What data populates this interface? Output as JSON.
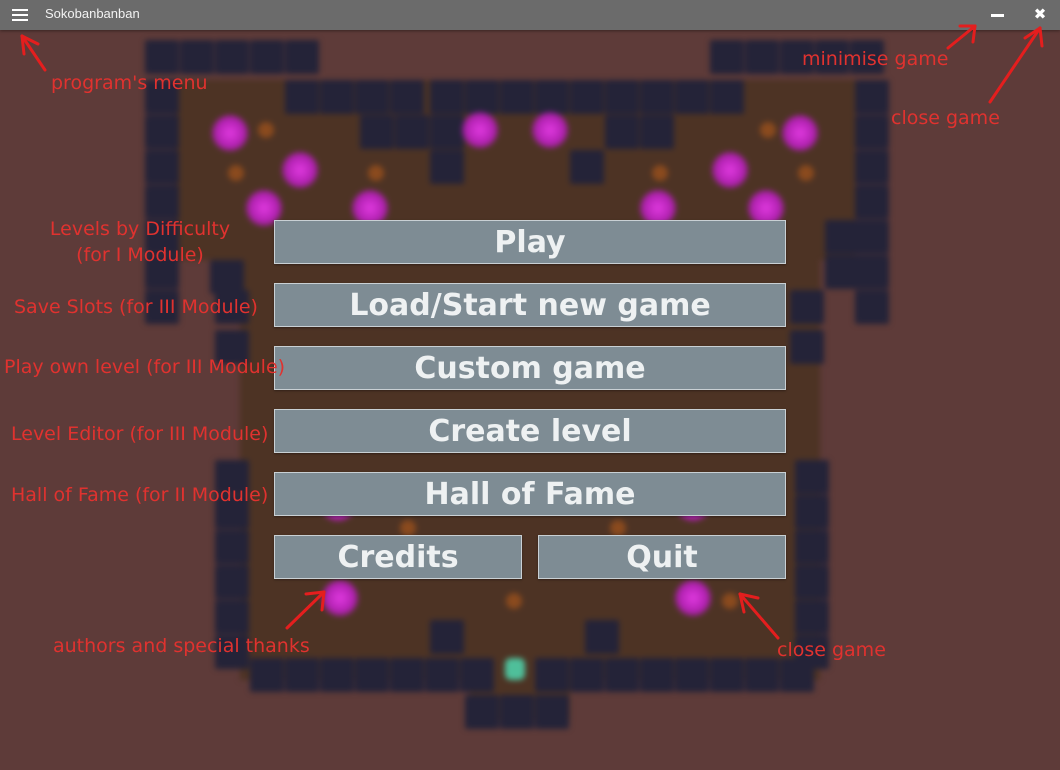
{
  "window": {
    "title": "Sokobanbanban",
    "menu_icon": "hamburger-menu-icon",
    "minimize_icon": "minimize-icon",
    "close_icon": "close-icon",
    "close_glyph": "✖"
  },
  "menu": {
    "play": "Play",
    "load": "Load/Start new game",
    "custom": "Custom game",
    "create": "Create level",
    "hall": "Hall of Fame",
    "credits": "Credits",
    "quit": "Quit"
  },
  "annotations": {
    "programs_menu": "program's menu",
    "minimise": "minimise game",
    "close_top": "close game",
    "levels_line1": "Levels by Difficulty",
    "levels_line2": "(for I Module)",
    "save_slots": "Save Slots (for III Module)",
    "play_own": "Play own level (for III Module)",
    "level_editor": "Level Editor (for III Module)",
    "hall_of_fame": "Hall of Fame (for II Module)",
    "authors": "authors and special thanks",
    "close_bottom": "close game"
  },
  "colors": {
    "annotation": "#e0322f",
    "button_bg": "#7e8c94",
    "background": "#5e3b39",
    "wall": "#242338",
    "orb": "#d52fd5"
  }
}
